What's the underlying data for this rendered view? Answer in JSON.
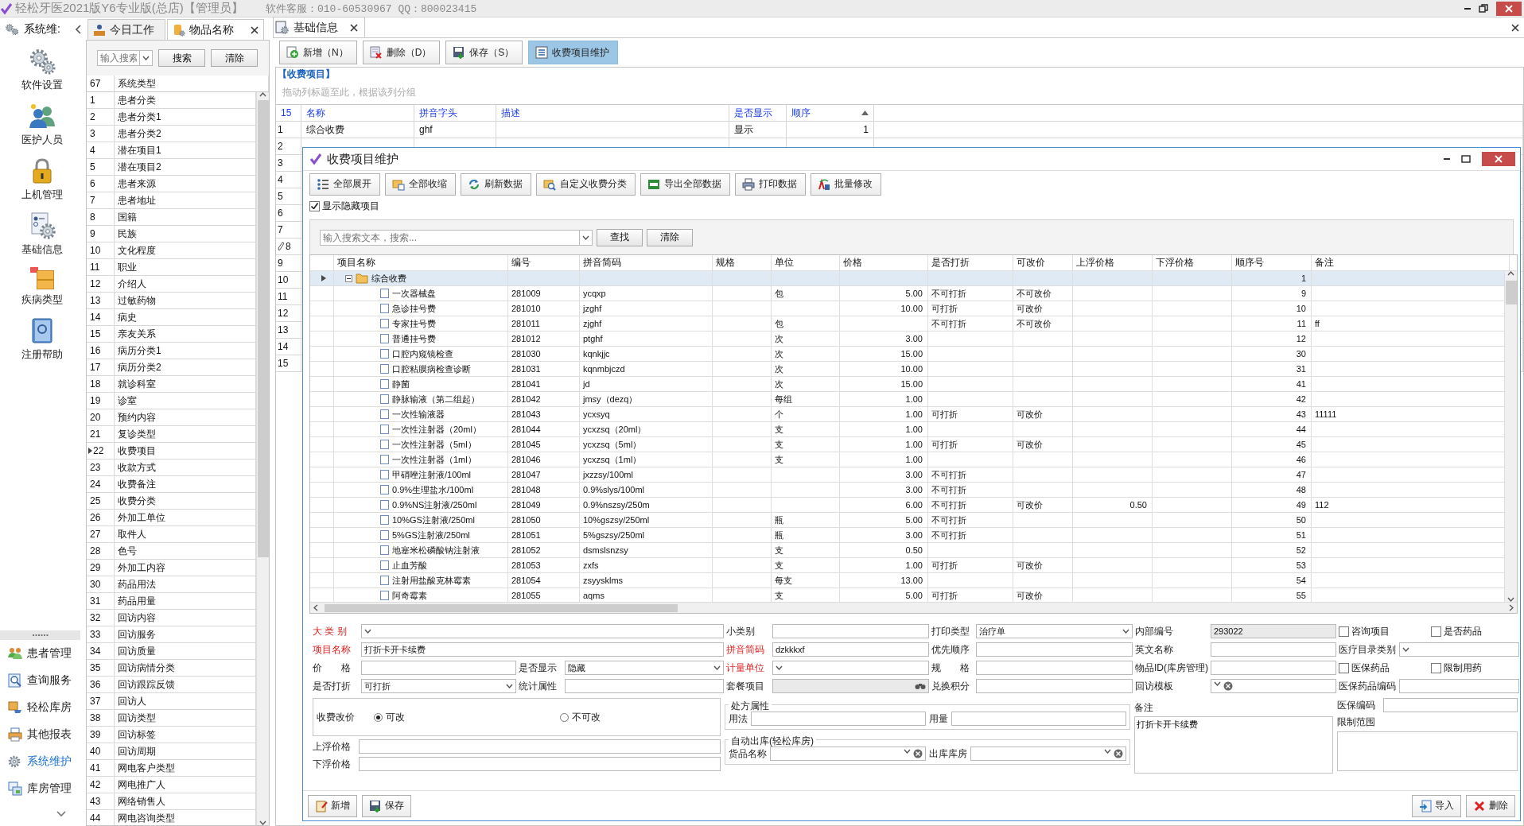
{
  "window": {
    "title": "轻松牙医2021版Y6专业版(总店)【管理员】",
    "support": "软件客服：010-60530967 QQ：800023415"
  },
  "nav": {
    "title": "系统维:",
    "top_items": [
      {
        "label": "软件设置",
        "selected": false
      },
      {
        "label": "医护人员",
        "selected": false
      },
      {
        "label": "上机管理",
        "selected": false
      },
      {
        "label": "基础信息",
        "selected": false
      },
      {
        "label": "疾病类型",
        "selected": false
      },
      {
        "label": "注册帮助",
        "selected": false
      }
    ],
    "bottom_items": [
      {
        "label": "患者管理",
        "selected": false
      },
      {
        "label": "查询服务",
        "selected": false
      },
      {
        "label": "轻松库房",
        "selected": false
      },
      {
        "label": "其他报表",
        "selected": false
      },
      {
        "label": "系统维护",
        "selected": true
      },
      {
        "label": "库房管理",
        "selected": false
      }
    ]
  },
  "list_tabs": [
    {
      "label": "今日工作",
      "selected": false,
      "closable": false
    },
    {
      "label": "物品名称",
      "selected": true,
      "closable": true
    }
  ],
  "list_search": {
    "placeholder": "输入搜索",
    "buttons": [
      "搜索",
      "清除"
    ]
  },
  "list_table": {
    "count": "67",
    "column": "系统类型",
    "rows": [
      {
        "no": "1",
        "name": "患者分类",
        "selected": false
      },
      {
        "no": "2",
        "name": "患者分类1",
        "selected": false
      },
      {
        "no": "3",
        "name": "患者分类2",
        "selected": false
      },
      {
        "no": "4",
        "name": "潜在项目1",
        "selected": false
      },
      {
        "no": "5",
        "name": "潜在项目2",
        "selected": false
      },
      {
        "no": "6",
        "name": "患者来源",
        "selected": false
      },
      {
        "no": "7",
        "name": "患者地址",
        "selected": false
      },
      {
        "no": "8",
        "name": "国籍",
        "selected": false
      },
      {
        "no": "9",
        "name": "民族",
        "selected": false
      },
      {
        "no": "10",
        "name": "文化程度",
        "selected": false
      },
      {
        "no": "11",
        "name": "职业",
        "selected": false
      },
      {
        "no": "12",
        "name": "介绍人",
        "selected": false
      },
      {
        "no": "13",
        "name": "过敏药物",
        "selected": false
      },
      {
        "no": "14",
        "name": "病史",
        "selected": false
      },
      {
        "no": "15",
        "name": "亲友关系",
        "selected": false
      },
      {
        "no": "16",
        "name": "病历分类1",
        "selected": false
      },
      {
        "no": "17",
        "name": "病历分类2",
        "selected": false
      },
      {
        "no": "18",
        "name": "就诊科室",
        "selected": false
      },
      {
        "no": "19",
        "name": "诊室",
        "selected": false
      },
      {
        "no": "20",
        "name": "预约内容",
        "selected": false
      },
      {
        "no": "21",
        "name": "复诊类型",
        "selected": false
      },
      {
        "no": "22",
        "name": "收费项目",
        "selected": true
      },
      {
        "no": "23",
        "name": "收款方式",
        "selected": false
      },
      {
        "no": "24",
        "name": "收费备注",
        "selected": false
      },
      {
        "no": "25",
        "name": "收费分类",
        "selected": false
      },
      {
        "no": "26",
        "name": "外加工单位",
        "selected": false
      },
      {
        "no": "27",
        "name": "取件人",
        "selected": false
      },
      {
        "no": "28",
        "name": "色号",
        "selected": false
      },
      {
        "no": "29",
        "name": "外加工内容",
        "selected": false
      },
      {
        "no": "30",
        "name": "药品用法",
        "selected": false
      },
      {
        "no": "31",
        "name": "药品用量",
        "selected": false
      },
      {
        "no": "32",
        "name": "回访内容",
        "selected": false
      },
      {
        "no": "33",
        "name": "回访服务",
        "selected": false
      },
      {
        "no": "34",
        "name": "回访质量",
        "selected": false
      },
      {
        "no": "35",
        "name": "回访病情分类",
        "selected": false
      },
      {
        "no": "36",
        "name": "回访跟踪反馈",
        "selected": false
      },
      {
        "no": "37",
        "name": "回访人",
        "selected": false
      },
      {
        "no": "38",
        "name": "回访类型",
        "selected": false
      },
      {
        "no": "39",
        "name": "回访标签",
        "selected": false
      },
      {
        "no": "40",
        "name": "回访周期",
        "selected": false
      },
      {
        "no": "41",
        "name": "网电客户类型",
        "selected": false
      },
      {
        "no": "42",
        "name": "网电推广人",
        "selected": false
      },
      {
        "no": "43",
        "name": "网络销售人",
        "selected": false
      },
      {
        "no": "44",
        "name": "网电咨询类型",
        "selected": false
      }
    ]
  },
  "main_tabs": [
    {
      "label": "基础信息",
      "selected": true
    }
  ],
  "toolbar": [
    {
      "label": "新增（N）",
      "selected": false
    },
    {
      "label": "删除（D）",
      "selected": false
    },
    {
      "label": "保存（S）",
      "selected": false
    },
    {
      "label": "收费项目维护",
      "selected": true
    }
  ],
  "section_title": "【收费项目】",
  "group_hint": "拖动列标题至此，根据该列分组",
  "grid": {
    "count": "15",
    "columns": [
      "名称",
      "拼音字头",
      "描述",
      "是否显示",
      "顺序"
    ],
    "rows": [
      {
        "no": "1",
        "name": "综合收费",
        "pinyin": "ghf",
        "visible": "显示",
        "order": "1",
        "editing": false
      },
      {
        "no": "2",
        "editing": false
      },
      {
        "no": "3",
        "editing": false
      },
      {
        "no": "4",
        "editing": false
      },
      {
        "no": "5",
        "editing": false
      },
      {
        "no": "6",
        "editing": false
      },
      {
        "no": "7",
        "editing": false
      },
      {
        "no": "8",
        "editing": true
      },
      {
        "no": "9",
        "editing": false
      },
      {
        "no": "10",
        "editing": false
      },
      {
        "no": "11",
        "editing": false
      },
      {
        "no": "12",
        "editing": false
      },
      {
        "no": "13",
        "editing": false
      },
      {
        "no": "14",
        "editing": false
      },
      {
        "no": "15",
        "editing": false
      }
    ]
  },
  "dialog": {
    "title": "收费项目维护",
    "toolbar": [
      "全部展开",
      "全部收缩",
      "刷新数据",
      "自定义收费分类",
      "导出全部数据",
      "打印数据",
      "批量修改"
    ],
    "show_hidden": {
      "label": "显示隐藏项目",
      "checked": true
    },
    "search": {
      "placeholder": "输入搜索文本，搜索...",
      "buttons": [
        "查找",
        "清除"
      ]
    },
    "table": {
      "columns": [
        "项目名称",
        "编号",
        "拼音简码",
        "规格",
        "单位",
        "价格",
        "是否打折",
        "可改价",
        "上浮价格",
        "下浮价格",
        "顺序号",
        "备注"
      ],
      "group": {
        "name": "综合收费",
        "order": "1",
        "expanded": true,
        "selected": true
      },
      "rows": [
        {
          "name": "一次器械盘",
          "code": "281009",
          "pinyin": "ycqxp",
          "unit": "包",
          "price": "5.00",
          "discount": "不可打折",
          "change": "不可改价",
          "order": "9"
        },
        {
          "name": "急诊挂号费",
          "code": "281010",
          "pinyin": "jzghf",
          "price": "10.00",
          "discount": "可打折",
          "change": "可改价",
          "order": "10"
        },
        {
          "name": "专家挂号费",
          "code": "281011",
          "pinyin": "zjghf",
          "unit": "包",
          "discount": "不可打折",
          "change": "不可改价",
          "order": "11",
          "note": "ff"
        },
        {
          "name": "普通挂号费",
          "code": "281012",
          "pinyin": "ptghf",
          "unit": "次",
          "price": "3.00",
          "order": "12"
        },
        {
          "name": "口腔内窥镜检查",
          "code": "281030",
          "pinyin": "kqnkjjc",
          "unit": "次",
          "price": "15.00",
          "order": "30"
        },
        {
          "name": "口腔粘膜病检查诊断",
          "code": "281031",
          "pinyin": "kqnmbjczd",
          "unit": "次",
          "price": "10.00",
          "order": "31"
        },
        {
          "name": "静菌",
          "code": "281041",
          "pinyin": "jd",
          "unit": "次",
          "price": "15.00",
          "order": "41"
        },
        {
          "name": "静脉输液（第二组起）",
          "code": "281042",
          "pinyin": "jmsy（dezq）",
          "unit": "每组",
          "price": "1.00",
          "order": "42"
        },
        {
          "name": "一次性输液器",
          "code": "281043",
          "pinyin": "ycxsyq",
          "unit": "个",
          "price": "1.00",
          "discount": "可打折",
          "change": "可改价",
          "order": "43",
          "note": "11111"
        },
        {
          "name": "一次性注射器（20ml）",
          "code": "281044",
          "pinyin": "ycxzsq（20ml）",
          "unit": "支",
          "price": "1.00",
          "order": "44"
        },
        {
          "name": "一次性注射器（5ml）",
          "code": "281045",
          "pinyin": "ycxzsq（5ml）",
          "unit": "支",
          "price": "1.00",
          "discount": "可打折",
          "change": "可改价",
          "order": "45"
        },
        {
          "name": "一次性注射器（1ml）",
          "code": "281046",
          "pinyin": "ycxzsq（1ml）",
          "unit": "支",
          "price": "1.00",
          "order": "46"
        },
        {
          "name": "甲硝唑注射液/100ml",
          "code": "281047",
          "pinyin": "jxzzsy/100ml",
          "price": "3.00",
          "discount": "不可打折",
          "order": "47"
        },
        {
          "name": "0.9%生理盐水/100ml",
          "code": "281048",
          "pinyin": "0.9%slys/100ml",
          "price": "3.00",
          "discount": "不可打折",
          "order": "48"
        },
        {
          "name": "0.9%NS注射液/250ml",
          "code": "281049",
          "pinyin": "0.9%nszsy/250m",
          "price": "6.00",
          "discount": "不可打折",
          "change": "可改价",
          "up": "0.50",
          "order": "49",
          "note": "112"
        },
        {
          "name": "10%GS注射液/250ml",
          "code": "281050",
          "pinyin": "10%gszsy/250ml",
          "unit": "瓶",
          "price": "5.00",
          "discount": "不可打折",
          "order": "50"
        },
        {
          "name": "5%GS注射液/250ml",
          "code": "281051",
          "pinyin": "5%gszsy/250ml",
          "unit": "瓶",
          "price": "3.00",
          "discount": "不可打折",
          "order": "51"
        },
        {
          "name": "地塞米松磷酸钠注射液",
          "code": "281052",
          "pinyin": "dsmslsnzsy",
          "unit": "支",
          "price": "0.50",
          "order": "52"
        },
        {
          "name": "止血芳酸",
          "code": "281053",
          "pinyin": "zxfs",
          "unit": "支",
          "price": "1.00",
          "discount": "可打折",
          "change": "可改价",
          "order": "53"
        },
        {
          "name": "注射用盐酸克林霉素",
          "code": "281054",
          "pinyin": "zsyysklms",
          "unit": "每支",
          "price": "13.00",
          "order": "54"
        },
        {
          "name": "阿奇霉素",
          "code": "281055",
          "pinyin": "aqms",
          "unit": "支",
          "price": "5.00",
          "discount": "可打折",
          "change": "可改价",
          "order": "55"
        }
      ]
    },
    "form": {
      "fields": [
        {
          "label": "大 类 别",
          "kind": "select",
          "required": true
        },
        {
          "label": "小类别",
          "kind": "text",
          "required": false
        },
        {
          "label": "打印类型",
          "kind": "select",
          "value": "治疗单",
          "required": false
        },
        {
          "label": "内部编号",
          "kind": "readonly",
          "value": "293022",
          "required": false
        },
        {
          "label": "咨询项目",
          "kind": "check",
          "checked": false
        },
        {
          "label": "是否药品",
          "kind": "check",
          "checked": false
        },
        {
          "label": "项目名称",
          "kind": "text",
          "value": "打折卡开卡续费",
          "required": true
        },
        {
          "label": "拼音简码",
          "kind": "text",
          "value": "dzkkkxf",
          "required": true
        },
        {
          "label": "优先顺序",
          "kind": "text",
          "required": false
        },
        {
          "label": "英文名称",
          "kind": "text",
          "required": false
        },
        {
          "label": "医疗目录类别",
          "kind": "select",
          "required": false
        },
        {
          "label": "价　　格",
          "kind": "text",
          "required": false
        },
        {
          "label": "是否显示",
          "kind": "select",
          "value": "隐藏",
          "required": false
        },
        {
          "label": "计量单位",
          "kind": "select",
          "required": true
        },
        {
          "label": "规　　格",
          "kind": "text",
          "required": false
        },
        {
          "label": "物品ID(库房管理)",
          "kind": "text",
          "required": false
        },
        {
          "label": "医保药品",
          "kind": "check",
          "checked": false
        },
        {
          "label": "限制用药",
          "kind": "check",
          "checked": false
        },
        {
          "label": "是否打折",
          "kind": "select",
          "value": "可打折",
          "required": false
        },
        {
          "label": "统计属性",
          "kind": "text",
          "required": false
        },
        {
          "label": "套餐项目",
          "kind": "lookup",
          "required": false
        },
        {
          "label": "兑换积分",
          "kind": "text",
          "required": false
        },
        {
          "label": "回访模板",
          "kind": "select-clear",
          "required": false
        },
        {
          "label": "医保药品编码",
          "kind": "text",
          "required": false
        }
      ],
      "price_change": {
        "label": "收费改价",
        "options": [
          {
            "label": "可改",
            "selected": true
          },
          {
            "label": "不可改",
            "selected": false
          }
        ]
      },
      "float_up": "上浮价格",
      "float_down": "下浮价格",
      "prescription": {
        "title": "处方属性",
        "fields": [
          "用法",
          "用量"
        ]
      },
      "auto_stock": {
        "title": "自动出库(轻松库房)",
        "fields": [
          "货品名称",
          "出库库房"
        ]
      },
      "note": {
        "label": "备注",
        "value": "打折卡开卡续费"
      },
      "insurance_code": "医保编码",
      "limit_range": "限制范围"
    },
    "footer": {
      "left": [
        "新增",
        "保存"
      ],
      "right": [
        "导入",
        "删除"
      ]
    }
  }
}
